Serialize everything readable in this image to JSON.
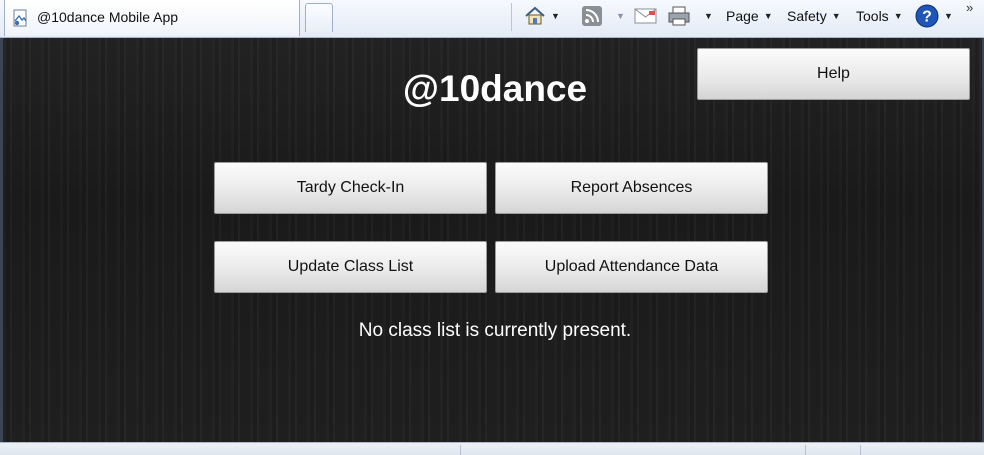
{
  "browser": {
    "tab_title": "@10dance Mobile App",
    "toolbar": {
      "home_icon": "home-icon",
      "feeds_icon": "rss-icon",
      "mail_icon": "read-mail-icon",
      "print_icon": "print-icon",
      "page_label": "Page",
      "safety_label": "Safety",
      "tools_label": "Tools",
      "help_icon": "help-icon",
      "overflow": "»"
    }
  },
  "app": {
    "title": "@10dance",
    "help_label": "Help",
    "buttons": {
      "tardy": "Tardy Check-In",
      "absences": "Report Absences",
      "update_list": "Update Class List",
      "upload": "Upload Attendance Data"
    },
    "status_message": "No class list is currently present."
  },
  "colors": {
    "app_background": "#1e1e1e",
    "button_face": "#ececec",
    "chrome_blue": "#e3ebf6"
  }
}
